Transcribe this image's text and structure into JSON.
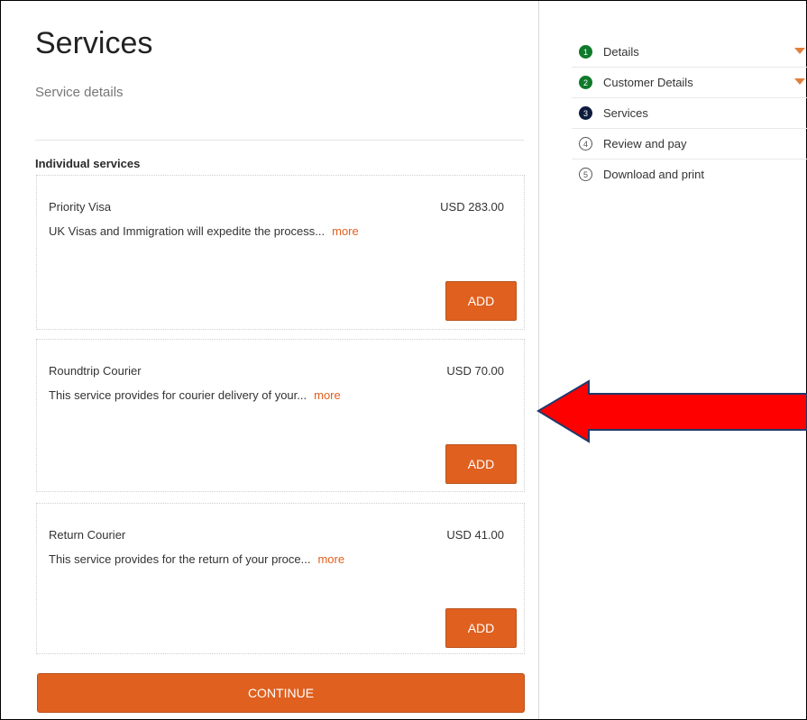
{
  "page": {
    "title": "Services",
    "subtitle": "Service details",
    "section_heading": "Individual services"
  },
  "services": [
    {
      "name": "Priority Visa",
      "price": "USD 283.00",
      "description": "UK Visas and Immigration will expedite the process...",
      "more": "more",
      "add_label": "ADD"
    },
    {
      "name": "Roundtrip Courier",
      "price": "USD 70.00",
      "description": "This service provides for courier delivery of your...",
      "more": "more",
      "add_label": "ADD"
    },
    {
      "name": "Return Courier",
      "price": "USD 41.00",
      "description": "This service provides for the return of your proce...",
      "more": "more",
      "add_label": "ADD"
    }
  ],
  "continue_label": "CONTINUE",
  "steps": [
    {
      "number": "1",
      "label": "Details",
      "status": "done"
    },
    {
      "number": "2",
      "label": "Customer Details",
      "status": "done"
    },
    {
      "number": "3",
      "label": "Services",
      "status": "current"
    },
    {
      "number": "4",
      "label": "Review and pay",
      "status": "upcoming"
    },
    {
      "number": "5",
      "label": "Download and print",
      "status": "upcoming"
    }
  ],
  "colors": {
    "accent": "#e0601f",
    "step_done": "#0f7a2a",
    "step_current": "#0d1b3d",
    "annotation_arrow": "#ff0000"
  }
}
